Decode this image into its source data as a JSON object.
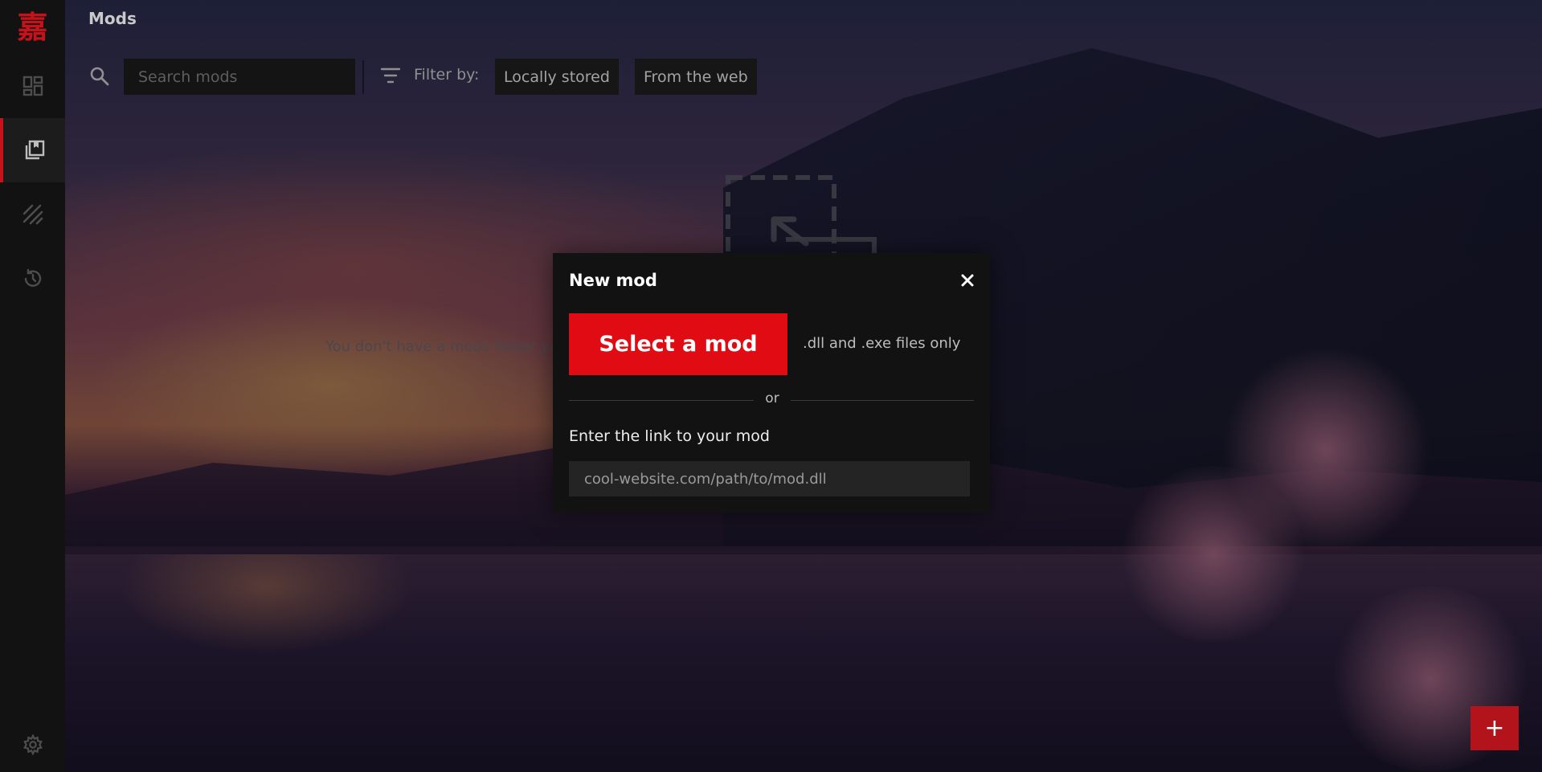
{
  "app": {
    "logo_text": "嘉",
    "accent_color": "#e10c13"
  },
  "sidebar": {
    "items": [
      {
        "name": "dashboard-icon",
        "active": false
      },
      {
        "name": "mods-library-icon",
        "active": true
      },
      {
        "name": "slashes-icon",
        "active": false
      },
      {
        "name": "history-icon",
        "active": false
      }
    ],
    "settings_icon": "gear-icon"
  },
  "header": {
    "title": "Mods",
    "search_placeholder": "Search mods",
    "filter_label": "Filter by:",
    "filters": [
      "Locally stored",
      "From the web"
    ]
  },
  "empty_state": {
    "text": "You don't have a mods folder yet. Create one or add mods to create a new folder."
  },
  "modal": {
    "title": "New mod",
    "select_button": "Select a mod",
    "file_types_note": ".dll and .exe files only",
    "separator": "or",
    "link_label": "Enter the link to your mod",
    "link_placeholder": "cool-website.com/path/to/mod.dll"
  },
  "fab": {
    "label": "+"
  }
}
